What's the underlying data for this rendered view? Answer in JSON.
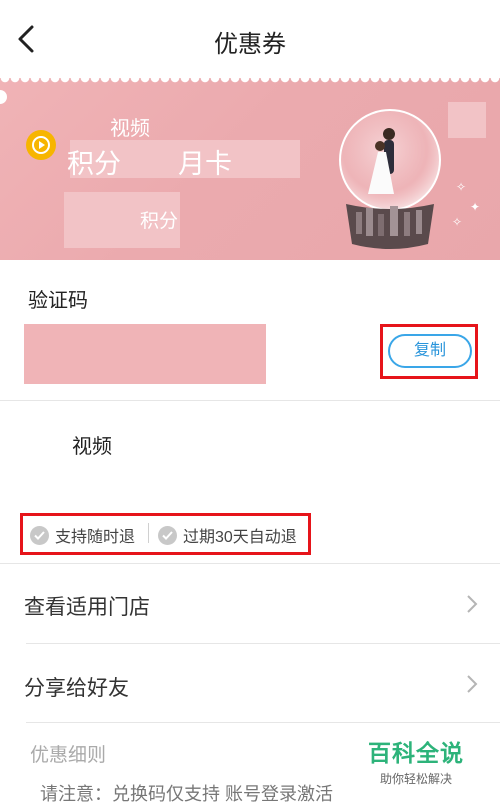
{
  "header": {
    "title": "优惠券"
  },
  "banner": {
    "line_video": "视频",
    "line_points": "积分",
    "line_month_card": "月卡",
    "line_points_2": "积分"
  },
  "verification": {
    "title": "验证码",
    "copy_label": "复制"
  },
  "product": {
    "name": "视频"
  },
  "tags": [
    {
      "label": "支持随时退",
      "icon": "check-circle-icon"
    },
    {
      "label": "过期30天自动退",
      "icon": "check-circle-icon"
    }
  ],
  "rows": [
    {
      "label": "查看适用门店",
      "icon": "chevron-right-icon"
    },
    {
      "label": "分享给好友",
      "icon": "chevron-right-icon"
    }
  ],
  "details": {
    "title": "优惠细则",
    "note": "请注意：兑换码仅支持 账号登录激活"
  },
  "watermark": {
    "title": "百科全说",
    "subtitle": "助你轻松解决"
  },
  "colors": {
    "banner_pink": "#eaaaae",
    "redaction": "#f0b4b7",
    "highlight_red": "#e6141a",
    "copy_blue": "#2a95db",
    "watermark_green": "#2db37a"
  }
}
